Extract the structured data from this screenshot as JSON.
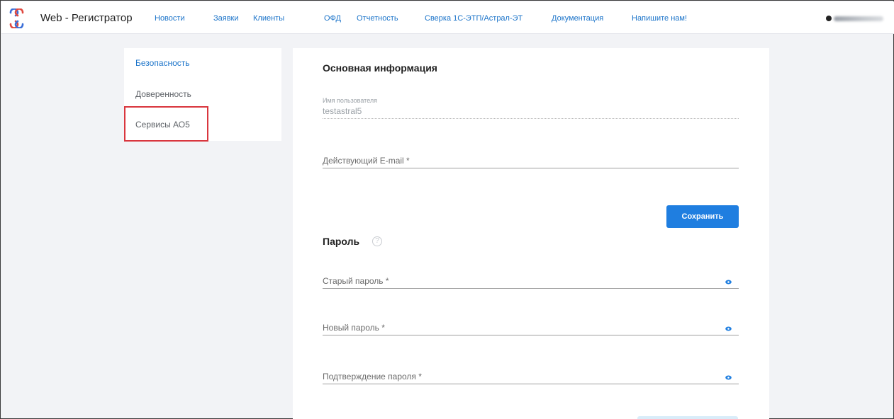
{
  "app": {
    "brand": "Web - Регистратор",
    "colors": {
      "accent": "#1f7ee0",
      "highlight": "#d9363e"
    }
  },
  "nav": {
    "items": [
      {
        "label": "Новости"
      },
      {
        "label": "Заявки"
      },
      {
        "label": "Клиенты"
      },
      {
        "label": "ОФД"
      },
      {
        "label": "Отчетность"
      },
      {
        "label": "Сверка 1С-ЭТП/Астрал-ЭТ"
      },
      {
        "label": "Документация"
      },
      {
        "label": "Напишите нам!"
      }
    ]
  },
  "sidebar": {
    "items": [
      {
        "label": "Безопасность",
        "icon": ""
      },
      {
        "label": "Доверенность"
      },
      {
        "label": "Сервисы АО5"
      }
    ]
  },
  "main": {
    "basic_info": {
      "title": "Основная информация",
      "username_label": "Имя пользователя",
      "username_value": "testastral5",
      "email_label": "Действующий E-mail *",
      "save_label": "Сохранить"
    },
    "password": {
      "title": "Пароль",
      "help_icon": "?",
      "old_label": "Старый пароль *",
      "new_label": "Новый пароль *",
      "confirm_label": "Подтверждение пароля *",
      "visibility_icon": "eye-icon"
    }
  }
}
